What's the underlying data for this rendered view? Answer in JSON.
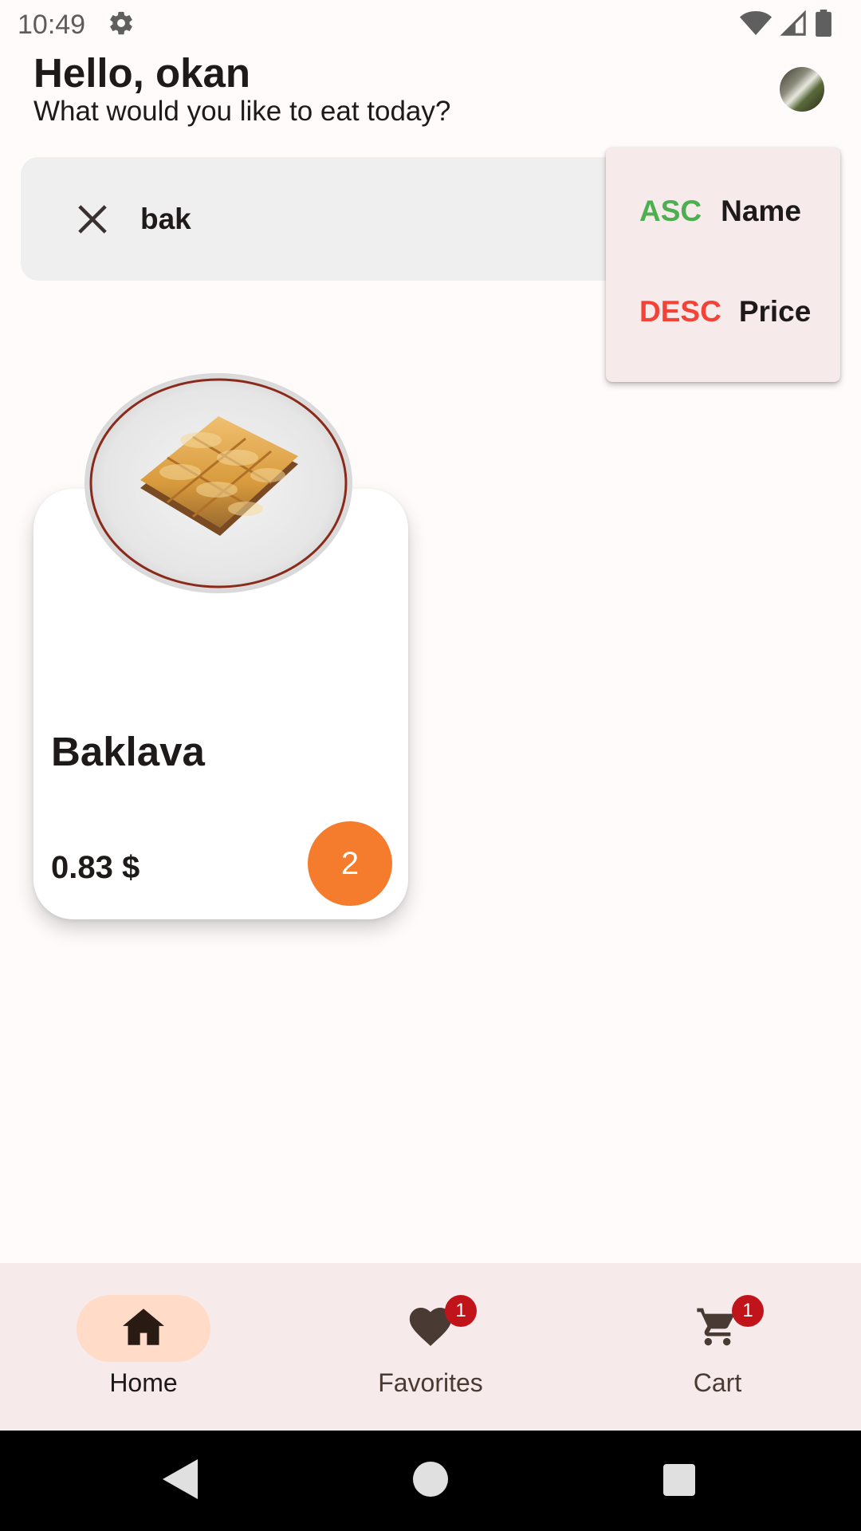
{
  "status_bar": {
    "time": "10:49",
    "icons": [
      "settings-gear-icon",
      "wifi-icon",
      "signal-icon",
      "battery-icon"
    ]
  },
  "header": {
    "greeting": "Hello, okan",
    "subtitle": "What would you like to eat today?"
  },
  "search": {
    "value": "bak",
    "clear_icon": "close-icon"
  },
  "sort_menu": {
    "items": [
      {
        "direction": "ASC",
        "field": "Name",
        "direction_color": "#4caf50"
      },
      {
        "direction": "DESC",
        "field": "Price",
        "direction_color": "#f44336"
      }
    ]
  },
  "products": [
    {
      "name": "Baklava",
      "price": "0.83 $",
      "quantity": "2"
    }
  ],
  "bottom_nav": {
    "items": [
      {
        "label": "Home",
        "icon": "home-icon",
        "active": true
      },
      {
        "label": "Favorites",
        "icon": "heart-icon",
        "badge": "1"
      },
      {
        "label": "Cart",
        "icon": "cart-icon",
        "badge": "1"
      }
    ]
  },
  "colors": {
    "accent": "#f47c2c",
    "nav_active": "#ffdbc8",
    "badge": "#c0141a"
  }
}
